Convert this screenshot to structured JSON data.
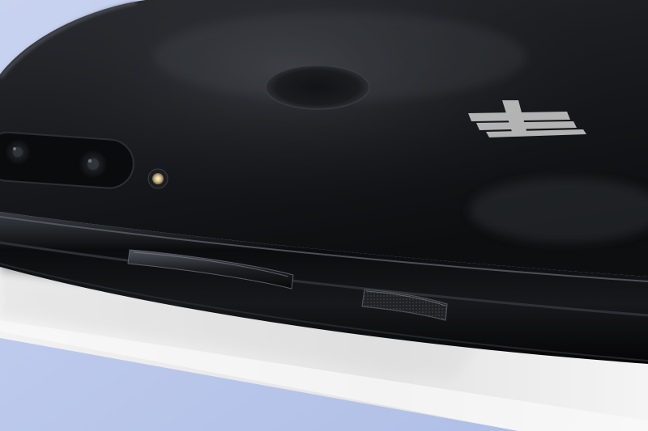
{
  "photo": {
    "subject": "",
    "background_color": "#b9c7ea",
    "paper_color": "#eeeeee",
    "phone_color": "#0e0f12",
    "flash_color": "#e8d9a8",
    "icons": [
      "camera-lens-icon",
      "flash-icon",
      "fingerprint-sensor-icon",
      "brand-logo-icon",
      "volume-button-icon",
      "power-button-icon"
    ]
  }
}
